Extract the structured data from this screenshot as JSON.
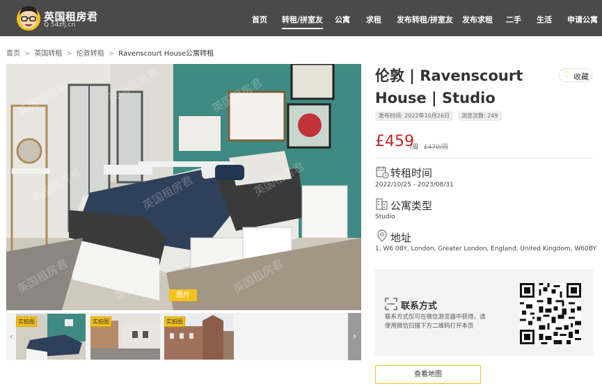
{
  "brand": {
    "name": "英国租房君",
    "domain": "54zfj.cn"
  },
  "nav": [
    {
      "label": "首页",
      "active": false
    },
    {
      "label": "转租/拼室友",
      "active": true
    },
    {
      "label": "公寓",
      "active": false
    },
    {
      "label": "求租",
      "active": false
    },
    {
      "label": "发布转租/拼室友",
      "active": false
    },
    {
      "label": "发布求租",
      "active": false
    },
    {
      "label": "二手",
      "active": false
    },
    {
      "label": "生活",
      "active": false
    },
    {
      "label": "申请公寓",
      "active": false
    }
  ],
  "breadcrumb": {
    "items": [
      "首页",
      "英国转租",
      "伦敦转租"
    ],
    "current": "Ravenscourt House公寓转租",
    "separator": ">"
  },
  "gallery": {
    "main_tag": "图片",
    "thumbnails": [
      {
        "label": "实拍图"
      },
      {
        "label": "实拍图"
      },
      {
        "label": "实拍图"
      }
    ],
    "prev_arrow": "‹",
    "next_arrow": "›"
  },
  "listing": {
    "title": "伦敦 | Ravenscourt House | Studio",
    "favorite_label": "收藏",
    "published": "发布时间: 2022年10月26日",
    "views": "浏览次数: 249",
    "price": "£459",
    "price_unit": "/周",
    "price_old": "£470/周"
  },
  "info": {
    "sublet_title": "转租时间",
    "sublet_value": "2022/10/25 - 2023/08/31",
    "type_title": "公寓类型",
    "type_value": "Studio",
    "address_title": "地址",
    "address_value": "1, W6 0BY, London, Greater London, England, United Kingdom, W60BY"
  },
  "contact": {
    "title": "联系方式",
    "description": "联系方式仅可在微信游览器中获得，请使用微信扫描下方二维码打开本页"
  },
  "map_button": "查看地图",
  "colors": {
    "header_bg": "#4a4a4a",
    "accent": "#f4c21c",
    "price": "#c0272d"
  }
}
